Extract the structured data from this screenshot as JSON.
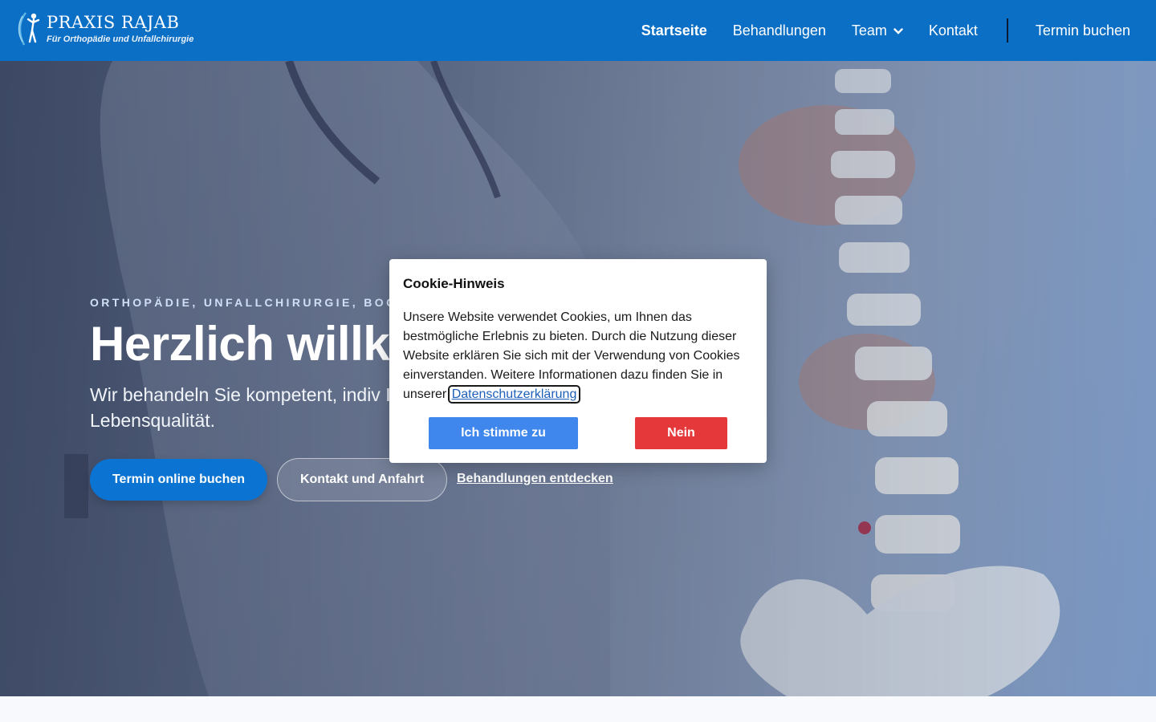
{
  "header": {
    "logo_title": "PRAXIS RAJAB",
    "logo_subtitle": "Für Orthopädie und Unfallchirurgie",
    "nav": {
      "home": "Startseite",
      "treatments": "Behandlungen",
      "team": "Team",
      "contact": "Kontakt",
      "booking": "Termin buchen"
    }
  },
  "hero": {
    "eyebrow": "ORTHOPÄDIE, UNFALLCHIRURGIE, BOCH",
    "title": "Herzlich willko",
    "text": "Wir behandeln Sie kompetent, indiv Ihre Lebensqualität.",
    "buttons": {
      "book_online": "Termin online buchen",
      "contact_directions": "Kontakt und Anfahrt",
      "discover_treatments": "Behandlungen entdecken"
    }
  },
  "cookie_notice": {
    "title": "Cookie-Hinweis",
    "text": "Unsere Website verwendet Cookies, um Ihnen das bestmögliche Erlebnis zu bieten. Durch die Nutzung dieser Website erklären Sie sich mit der Verwendung von Cookies einverstanden. Weitere Informationen dazu finden Sie in unserer",
    "link": "Datenschutzerklärung",
    "accept": "Ich stimme zu",
    "decline": "Nein"
  },
  "colors": {
    "header_bg": "#0b6fc6",
    "primary_button": "#0b73d1",
    "accept_button": "#3f87ec",
    "decline_button": "#e5383b"
  },
  "icons": {
    "logo": "runner-figure-icon",
    "team_dropdown": "chevron-down-icon"
  }
}
